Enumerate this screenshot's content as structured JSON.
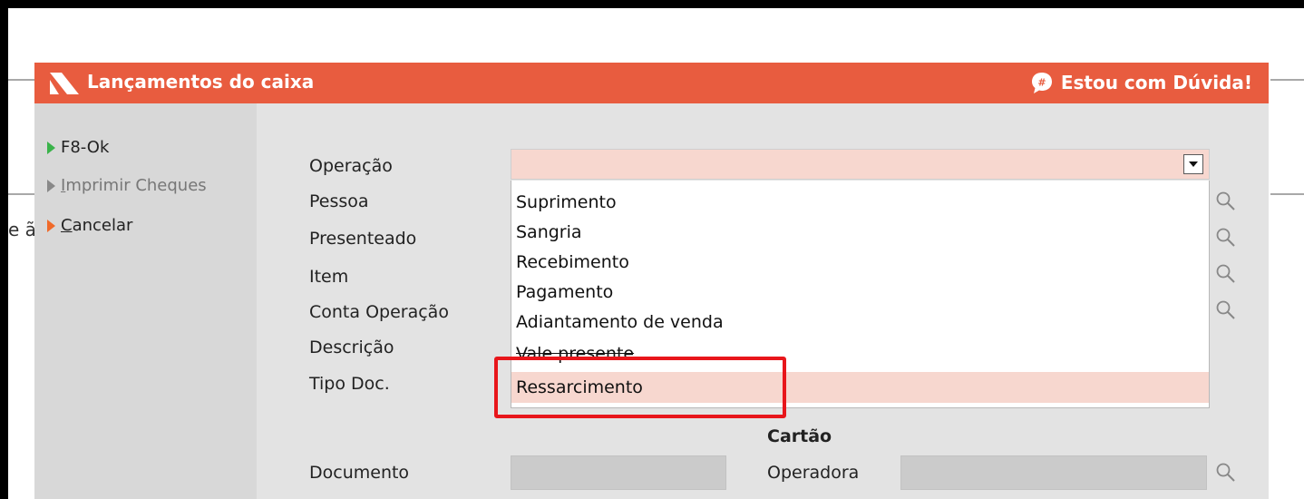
{
  "dialog": {
    "title": "Lançamentos do caixa",
    "help_label": "Estou com Dúvida!",
    "accent": "#e85c3f"
  },
  "sidebar": {
    "items": [
      {
        "label": "F8-Ok",
        "state": "enabled",
        "icon": "green-triangle-icon"
      },
      {
        "label": "Imprimir Cheques",
        "state": "disabled",
        "icon": "grey-triangle-icon"
      },
      {
        "label": "Cancelar",
        "state": "enabled",
        "icon": "orange-triangle-icon"
      }
    ]
  },
  "background": {
    "fragment": "e ã"
  },
  "form": {
    "labels": {
      "operacao": "Operação",
      "pessoa": "Pessoa",
      "presenteado": "Presenteado",
      "item": "Item",
      "conta_operacao": "Conta Operação",
      "descricao": "Descrição",
      "tipo_doc": "Tipo Doc.",
      "documento": "Documento"
    },
    "operacao": {
      "value": "",
      "options": [
        "Suprimento",
        "Sangria",
        "Recebimento",
        "Pagamento",
        "Adiantamento de venda",
        "Vale presente",
        "Ressarcimento"
      ],
      "highlighted_option": "Ressarcimento"
    }
  },
  "card_section": {
    "title": "Cartão",
    "operadora_label": "Operadora"
  },
  "icons": {
    "search": "search-icon",
    "dropdown": "dropdown-arrow-icon",
    "help": "speech-bubble-icon",
    "logo": "app-logo-icon"
  },
  "colors": {
    "selection": "#f7d7cf",
    "annotation": "#e8161b"
  }
}
